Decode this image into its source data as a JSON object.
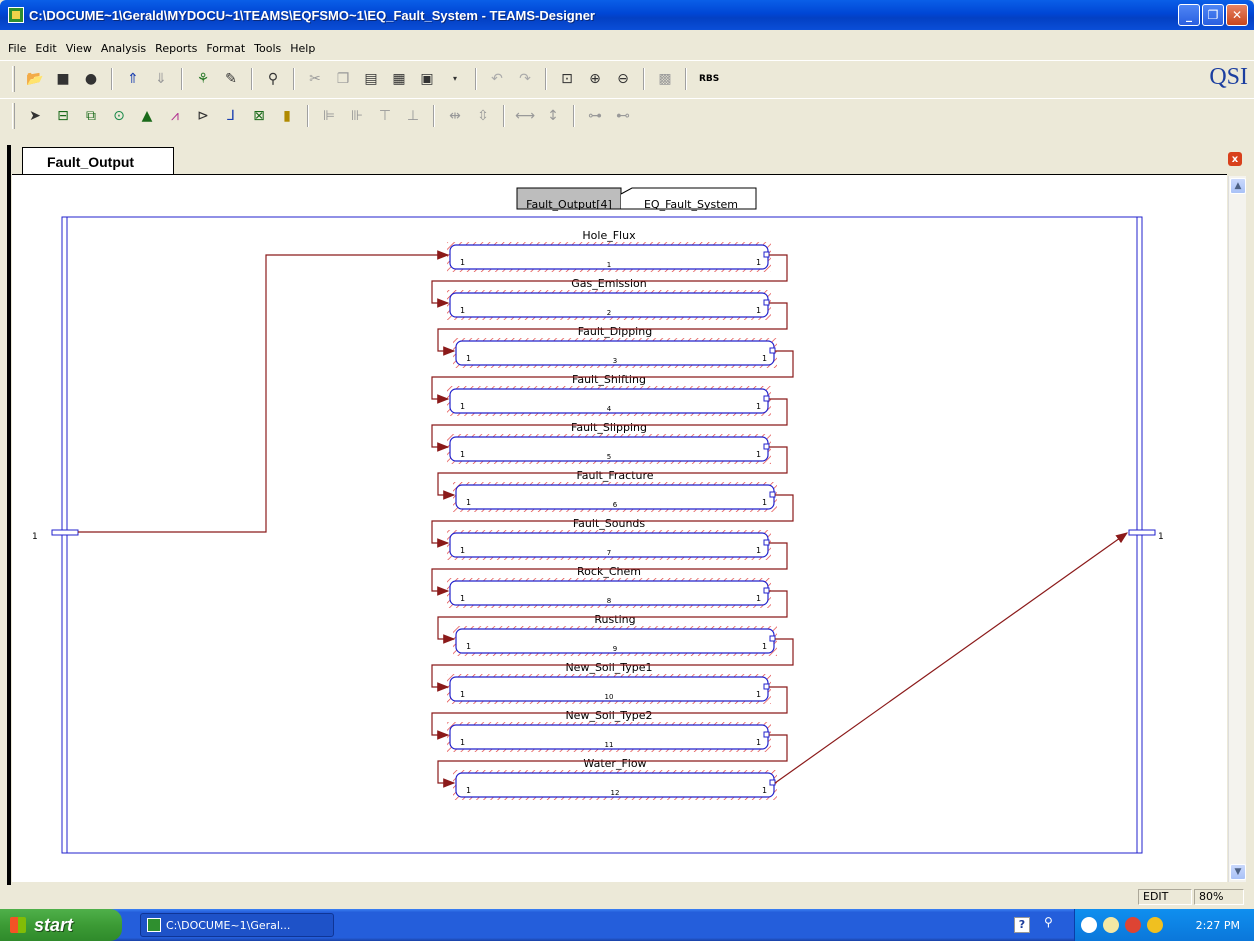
{
  "window": {
    "title": "C:\\DOCUME~1\\Gerald\\MYDOCU~1\\TEAMS\\EQFSMO~1\\EQ_Fault_System - TEAMS-Designer",
    "minimize": "_",
    "maximize": "❐",
    "close": "✕"
  },
  "menu": [
    "File",
    "Edit",
    "View",
    "Analysis",
    "Reports",
    "Format",
    "Tools",
    "Help"
  ],
  "toolbar": {
    "rbs_label": "RBS",
    "brand": "QSI"
  },
  "document": {
    "tab_label": "Fault_Output",
    "tab_close": "x",
    "breadcrumb_current": "Fault_Output[4]",
    "breadcrumb_parent": "EQ_Fault_System",
    "system_input_label": "1",
    "system_output_label": "1",
    "modules": [
      {
        "name": "Hole_Flux",
        "number": "1",
        "in_port": "1",
        "out_port": "1"
      },
      {
        "name": "Gas_Emission",
        "number": "2",
        "in_port": "1",
        "out_port": "1"
      },
      {
        "name": "Fault_Dipping",
        "number": "3",
        "in_port": "1",
        "out_port": "1"
      },
      {
        "name": "Fault_Shifting",
        "number": "4",
        "in_port": "1",
        "out_port": "1"
      },
      {
        "name": "Fault_Slipping",
        "number": "5",
        "in_port": "1",
        "out_port": "1"
      },
      {
        "name": "Fault_Fracture",
        "number": "6",
        "in_port": "1",
        "out_port": "1"
      },
      {
        "name": "Fault_Sounds",
        "number": "7",
        "in_port": "1",
        "out_port": "1"
      },
      {
        "name": "Rock_Chem",
        "number": "8",
        "in_port": "1",
        "out_port": "1"
      },
      {
        "name": "Rusting",
        "number": "9",
        "in_port": "1",
        "out_port": "1"
      },
      {
        "name": "New_Soil_Type1",
        "number": "10",
        "in_port": "1",
        "out_port": "1"
      },
      {
        "name": "New_Soil_Type2",
        "number": "11",
        "in_port": "1",
        "out_port": "1"
      },
      {
        "name": "Water_Flow",
        "number": "12",
        "in_port": "1",
        "out_port": "1"
      }
    ]
  },
  "status": {
    "mode": "EDIT",
    "zoom": "80%"
  },
  "taskbar": {
    "start_label": "start",
    "task_label": "C:\\DOCUME~1\\Geral...",
    "help_icon": "?",
    "clock": "2:27 PM"
  },
  "colors": {
    "wire": "#8b1a1a",
    "module_border": "#2222cc",
    "hatch": "#e04040",
    "frame": "#2222cc"
  }
}
